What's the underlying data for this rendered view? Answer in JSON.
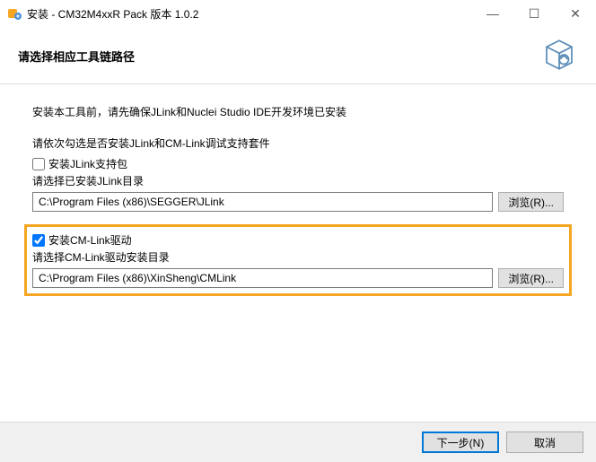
{
  "window": {
    "title": "安装 - CM32M4xxR Pack 版本 1.0.2",
    "minimize_glyph": "—",
    "maximize_glyph": "☐",
    "close_glyph": "✕"
  },
  "header": {
    "heading": "请选择相应工具链路径"
  },
  "body": {
    "intro": "安装本工具前，请先确保JLink和Nuclei Studio IDE开发环境已安装",
    "instruction": "请依次勾选是否安装JLink和CM-Link调试支持套件",
    "jlink": {
      "checkbox_label": "安装JLink支持包",
      "checked": false,
      "sublabel": "请选择已安装JLink目录",
      "path": "C:\\Program Files (x86)\\SEGGER\\JLink",
      "browse": "浏览(R)..."
    },
    "cmlink": {
      "checkbox_label": "安装CM-Link驱动",
      "checked": true,
      "sublabel": "请选择CM-Link驱动安装目录",
      "path": "C:\\Program Files (x86)\\XinSheng\\CMLink",
      "browse": "浏览(R)..."
    }
  },
  "footer": {
    "next": "下一步(N)",
    "cancel": "取消"
  }
}
